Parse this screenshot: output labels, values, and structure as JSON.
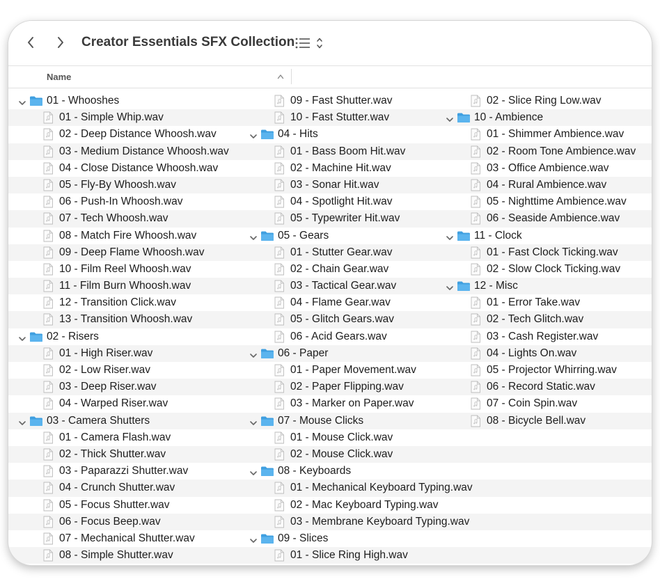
{
  "window": {
    "title": "Creator Essentials SFX Collection"
  },
  "header": {
    "name_column": "Name"
  },
  "columns": [
    [
      {
        "type": "folder",
        "label": "01 - Whooshes"
      },
      {
        "type": "file",
        "label": "01 - Simple Whip.wav"
      },
      {
        "type": "file",
        "label": "02 - Deep Distance Whoosh.wav"
      },
      {
        "type": "file",
        "label": "03 - Medium Distance Whoosh.wav"
      },
      {
        "type": "file",
        "label": "04 - Close Distance Whoosh.wav"
      },
      {
        "type": "file",
        "label": "05 - Fly-By Whoosh.wav"
      },
      {
        "type": "file",
        "label": "06 - Push-In Whoosh.wav"
      },
      {
        "type": "file",
        "label": "07 - Tech Whoosh.wav"
      },
      {
        "type": "file",
        "label": "08 - Match Fire Whoosh.wav"
      },
      {
        "type": "file",
        "label": "09 - Deep Flame Whoosh.wav"
      },
      {
        "type": "file",
        "label": "10 - Film Reel Whoosh.wav"
      },
      {
        "type": "file",
        "label": "11 - Film Burn Whoosh.wav"
      },
      {
        "type": "file",
        "label": "12 - Transition Click.wav"
      },
      {
        "type": "file",
        "label": "13 - Transition Whoosh.wav"
      },
      {
        "type": "folder",
        "label": "02 - Risers"
      },
      {
        "type": "file",
        "label": "01 - High Riser.wav"
      },
      {
        "type": "file",
        "label": "02 - Low Riser.wav"
      },
      {
        "type": "file",
        "label": "03 - Deep Riser.wav"
      },
      {
        "type": "file",
        "label": "04 - Warped Riser.wav"
      },
      {
        "type": "folder",
        "label": "03 - Camera Shutters"
      },
      {
        "type": "file",
        "label": "01 - Camera Flash.wav"
      },
      {
        "type": "file",
        "label": "02 - Thick Shutter.wav"
      },
      {
        "type": "file",
        "label": "03 - Paparazzi Shutter.wav"
      },
      {
        "type": "file",
        "label": "04 - Crunch Shutter.wav"
      },
      {
        "type": "file",
        "label": "05 - Focus Shutter.wav"
      },
      {
        "type": "file",
        "label": "06 - Focus Beep.wav"
      },
      {
        "type": "file",
        "label": "07 - Mechanical Shutter.wav"
      },
      {
        "type": "file",
        "label": "08 - Simple Shutter.wav"
      }
    ],
    [
      {
        "type": "file",
        "label": "09 - Fast Shutter.wav"
      },
      {
        "type": "file",
        "label": "10 - Fast Stutter.wav"
      },
      {
        "type": "folder",
        "label": "04 - Hits"
      },
      {
        "type": "file",
        "label": "01 - Bass Boom Hit.wav"
      },
      {
        "type": "file",
        "label": "02 - Machine Hit.wav"
      },
      {
        "type": "file",
        "label": "03 - Sonar Hit.wav"
      },
      {
        "type": "file",
        "label": "04 - Spotlight Hit.wav"
      },
      {
        "type": "file",
        "label": "05 - Typewriter Hit.wav"
      },
      {
        "type": "folder",
        "label": "05 - Gears"
      },
      {
        "type": "file",
        "label": "01 - Stutter Gear.wav"
      },
      {
        "type": "file",
        "label": "02 - Chain Gear.wav"
      },
      {
        "type": "file",
        "label": "03 - Tactical Gear.wav"
      },
      {
        "type": "file",
        "label": "04 - Flame Gear.wav"
      },
      {
        "type": "file",
        "label": "05 - Glitch Gears.wav"
      },
      {
        "type": "file",
        "label": "06 - Acid Gears.wav"
      },
      {
        "type": "folder",
        "label": "06 - Paper"
      },
      {
        "type": "file",
        "label": "01 - Paper Movement.wav"
      },
      {
        "type": "file",
        "label": "02 - Paper Flipping.wav"
      },
      {
        "type": "file",
        "label": "03 - Marker on Paper.wav"
      },
      {
        "type": "folder",
        "label": "07 - Mouse Clicks"
      },
      {
        "type": "file",
        "label": "01 - Mouse Click.wav"
      },
      {
        "type": "file",
        "label": "02 - Mouse Click.wav"
      },
      {
        "type": "folder",
        "label": "08 - Keyboards"
      },
      {
        "type": "file",
        "label": "01 - Mechanical Keyboard Typing.wav"
      },
      {
        "type": "file",
        "label": "02 - Mac Keyboard Typing.wav"
      },
      {
        "type": "file",
        "label": "03 - Membrane Keyboard Typing.wav"
      },
      {
        "type": "folder",
        "label": "09 - Slices"
      },
      {
        "type": "file",
        "label": "01 - Slice Ring High.wav"
      }
    ],
    [
      {
        "type": "file",
        "label": "02 - Slice Ring Low.wav"
      },
      {
        "type": "folder",
        "label": "10 - Ambience"
      },
      {
        "type": "file",
        "label": "01 - Shimmer Ambience.wav"
      },
      {
        "type": "file",
        "label": "02 - Room Tone Ambience.wav"
      },
      {
        "type": "file",
        "label": "03 - Office Ambience.wav"
      },
      {
        "type": "file",
        "label": "04 - Rural Ambience.wav"
      },
      {
        "type": "file",
        "label": "05 - Nighttime Ambience.wav"
      },
      {
        "type": "file",
        "label": "06 - Seaside Ambience.wav"
      },
      {
        "type": "folder",
        "label": "11 - Clock"
      },
      {
        "type": "file",
        "label": "01 - Fast Clock Ticking.wav"
      },
      {
        "type": "file",
        "label": "02 - Slow Clock Ticking.wav"
      },
      {
        "type": "folder",
        "label": "12 - Misc"
      },
      {
        "type": "file",
        "label": "01 - Error Take.wav"
      },
      {
        "type": "file",
        "label": "02 - Tech Glitch.wav"
      },
      {
        "type": "file",
        "label": "03 - Cash Register.wav"
      },
      {
        "type": "file",
        "label": "04 - Lights On.wav"
      },
      {
        "type": "file",
        "label": "05 - Projector Whirring.wav"
      },
      {
        "type": "file",
        "label": "06 - Record Static.wav"
      },
      {
        "type": "file",
        "label": "07 - Coin Spin.wav"
      },
      {
        "type": "file",
        "label": "08 - Bicycle Bell.wav"
      }
    ]
  ],
  "colors": {
    "folder": "#5bb4ee",
    "folder_tab": "#3f9fe0",
    "stripe": "#f4f4f4",
    "text": "#1d1d1d"
  },
  "icons": {
    "folder": "folder-icon",
    "file": "audio-file-icon",
    "disclosure": "chevron-down-icon"
  }
}
